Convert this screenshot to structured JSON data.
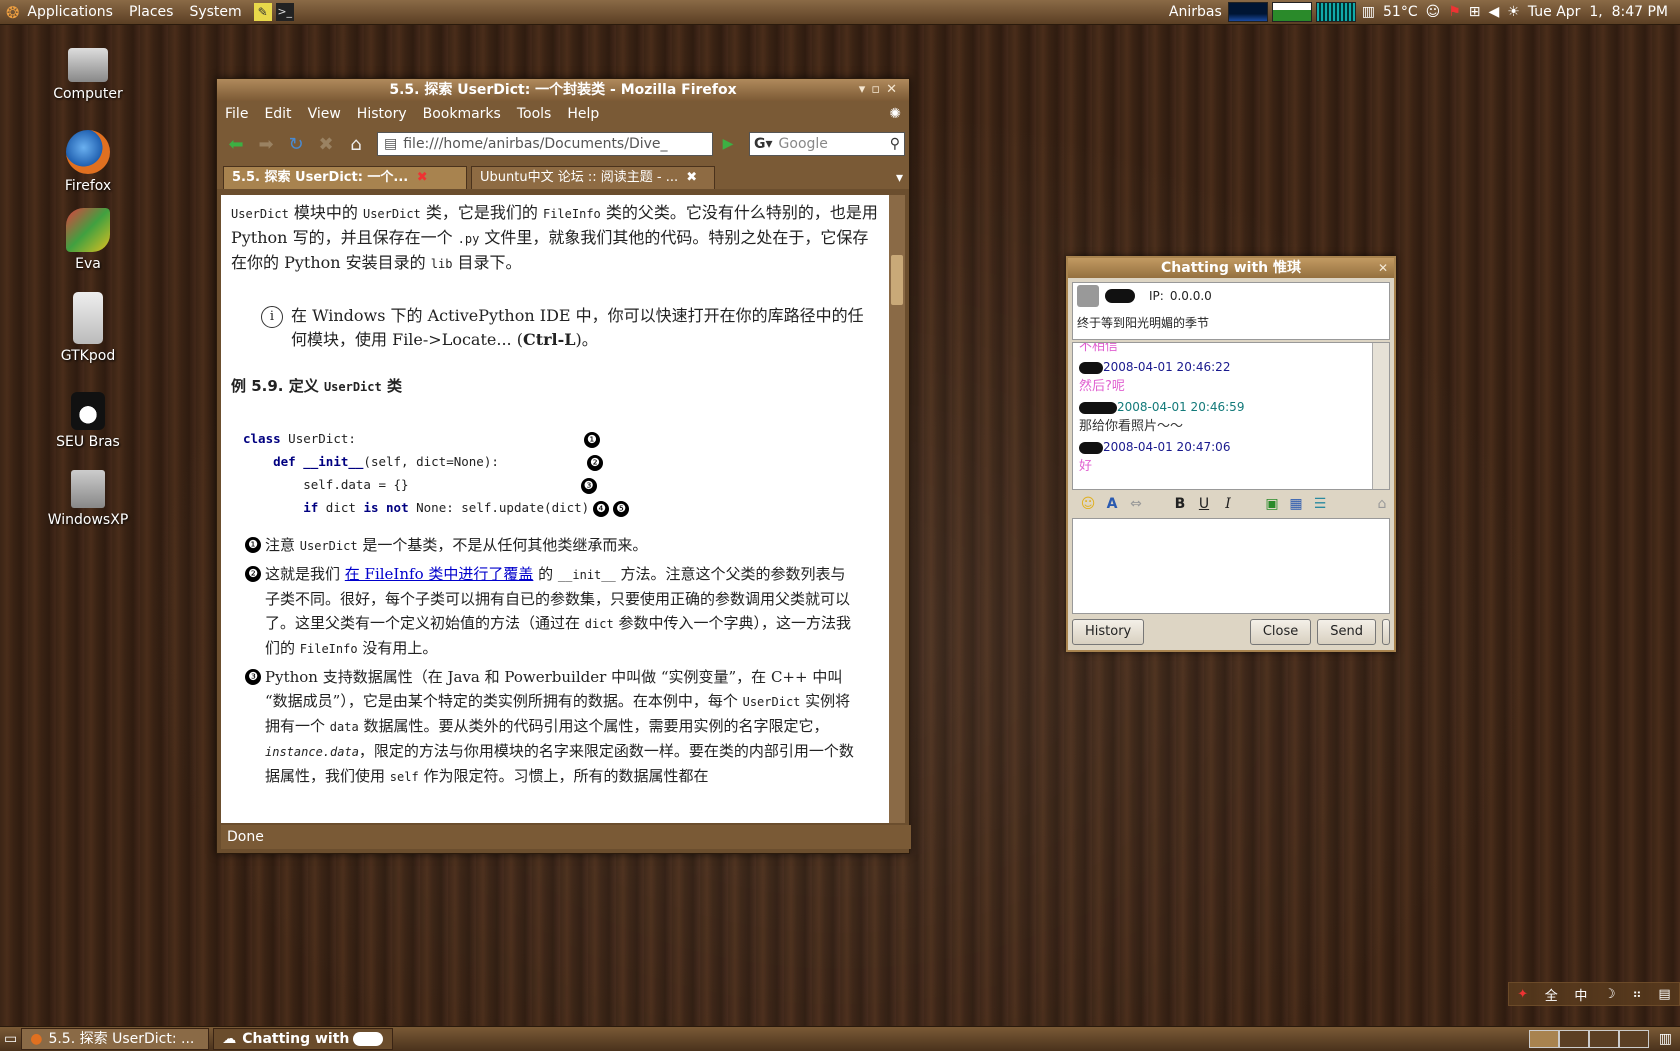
{
  "top_panel": {
    "menus": [
      "Applications",
      "Places",
      "System"
    ],
    "user": "Anirbas",
    "temperature": "51°C",
    "clock": "Tue Apr  1,  8:47 PM"
  },
  "desktop_icons": [
    {
      "label": "Computer",
      "icon": "computer-icon"
    },
    {
      "label": "Firefox",
      "icon": "firefox-icon"
    },
    {
      "label": "Eva",
      "icon": "eva-icon"
    },
    {
      "label": "GTKpod",
      "icon": "ipod-icon"
    },
    {
      "label": "SEU Bras",
      "icon": "tux-icon"
    },
    {
      "label": "WindowsXP",
      "icon": "drive-icon"
    }
  ],
  "firefox": {
    "title": "5.5. 探索 UserDict: 一个封装类 - Mozilla Firefox",
    "menu": [
      "File",
      "Edit",
      "View",
      "History",
      "Bookmarks",
      "Tools",
      "Help"
    ],
    "url": "file:///home/anirbas/Documents/Dive_",
    "search_placeholder": "Google",
    "tabs": [
      "5.5. 探索 UserDict: 一个...",
      "Ubuntu中文 论坛 :: 阅读主题 - ..."
    ],
    "status": "Done",
    "content": {
      "intro_1a": "UserDict",
      "intro_1b": " 模块中的 ",
      "intro_1c": "UserDict",
      "intro_1d": " 类，它是我们的 ",
      "intro_1e": "FileInfo",
      "intro_1f": " 类的父类。它没有什么特别的，也是用 Python 写的，并且保存在一个 ",
      "intro_1g": ".py",
      "intro_1h": " 文件里，就象我们其他的代码。特别之处在于，它保存在你的 Python 安装目录的 ",
      "intro_1i": "lib",
      "intro_1j": " 目录下。",
      "note_a": "在 Windows 下的 ActivePython IDE 中，你可以快速打开在你的库路径中的任何模块，使用 File->Locate... (",
      "note_b": "Ctrl-L",
      "note_c": ")。",
      "example_title": "例 5.9. 定义 ",
      "example_code": "UserDict",
      "example_suffix": " 类",
      "code_lines": [
        {
          "kw": "class",
          "text": " UserDict:",
          "marks": [
            "❶"
          ]
        },
        {
          "kw": "def",
          "fn": " __init__",
          "text": "(self, dict=None):",
          "marks": [
            "❷"
          ]
        },
        {
          "kw": "",
          "text": "self.data = {}",
          "marks": [
            "❸"
          ]
        },
        {
          "kw": "if",
          "text": " dict ",
          "kw2": "is not",
          "text2": " None: self.update(dict)",
          "marks": [
            "❹",
            "❺"
          ]
        }
      ],
      "callout_1a": "注意 ",
      "callout_1b": "UserDict",
      "callout_1c": " 是一个基类，不是从任何其他类继承而来。",
      "callout_2a": "这就是我们 ",
      "callout_2link": "在 FileInfo 类中进行了覆盖",
      "callout_2b": " 的 ",
      "callout_2c": "__init__",
      "callout_2d": " 方法。注意这个父类的参数列表与子类不同。很好，每个子类可以拥有自已的参数集，只要使用正确的参数调用父类就可以了。这里父类有一个定义初始值的方法（通过在 ",
      "callout_2e": "dict",
      "callout_2f": " 参数中传入一个字典），这一方法我们的 ",
      "callout_2g": "FileInfo",
      "callout_2h": " 没有用上。",
      "callout_3a": "Python 支持数据属性（在 Java 和 Powerbuilder 中叫做 “实例变量”，在 C++ 中叫 “数据成员”），它是由某个特定的类实例所拥有的数据。在本例中，每个 ",
      "callout_3b": "UserDict",
      "callout_3c": " 实例将拥有一个 ",
      "callout_3d": "data",
      "callout_3e": " 数据属性。要从类外的代码引用这个属性，需要用实例的名字限定它，",
      "callout_3f": "instance.data",
      "callout_3g": "，限定的方法与你用模块的名字来限定函数一样。要在类的内部引用一个数据属性，我们使用 ",
      "callout_3h": "self",
      "callout_3i": " 作为限定符。习惯上，所有的数据属性都在"
    }
  },
  "chat": {
    "title": "Chatting with 惟琪",
    "ip_label": "IP:",
    "ip_value": "0.0.0.0",
    "signature": "终于等到阳光明媚的季节",
    "messages": [
      {
        "type": "text",
        "text": "不相信"
      },
      {
        "type": "name",
        "text": "2008-04-01 20:46:22"
      },
      {
        "type": "text",
        "text": "然后?呢"
      },
      {
        "type": "name2",
        "text": "2008-04-01 20:46:59"
      },
      {
        "type": "text-dark",
        "text": "那给你看照片～～"
      },
      {
        "type": "name",
        "text": "2008-04-01 20:47:06"
      },
      {
        "type": "text",
        "text": "好"
      }
    ],
    "buttons": {
      "history": "History",
      "close": "Close",
      "send": "Send"
    }
  },
  "taskbar": {
    "tasks": [
      "5.5. 探索 UserDict: ...",
      "Chatting with"
    ]
  },
  "ime": {
    "items": [
      "全",
      "中",
      "☽",
      "⠶",
      "▤"
    ]
  }
}
